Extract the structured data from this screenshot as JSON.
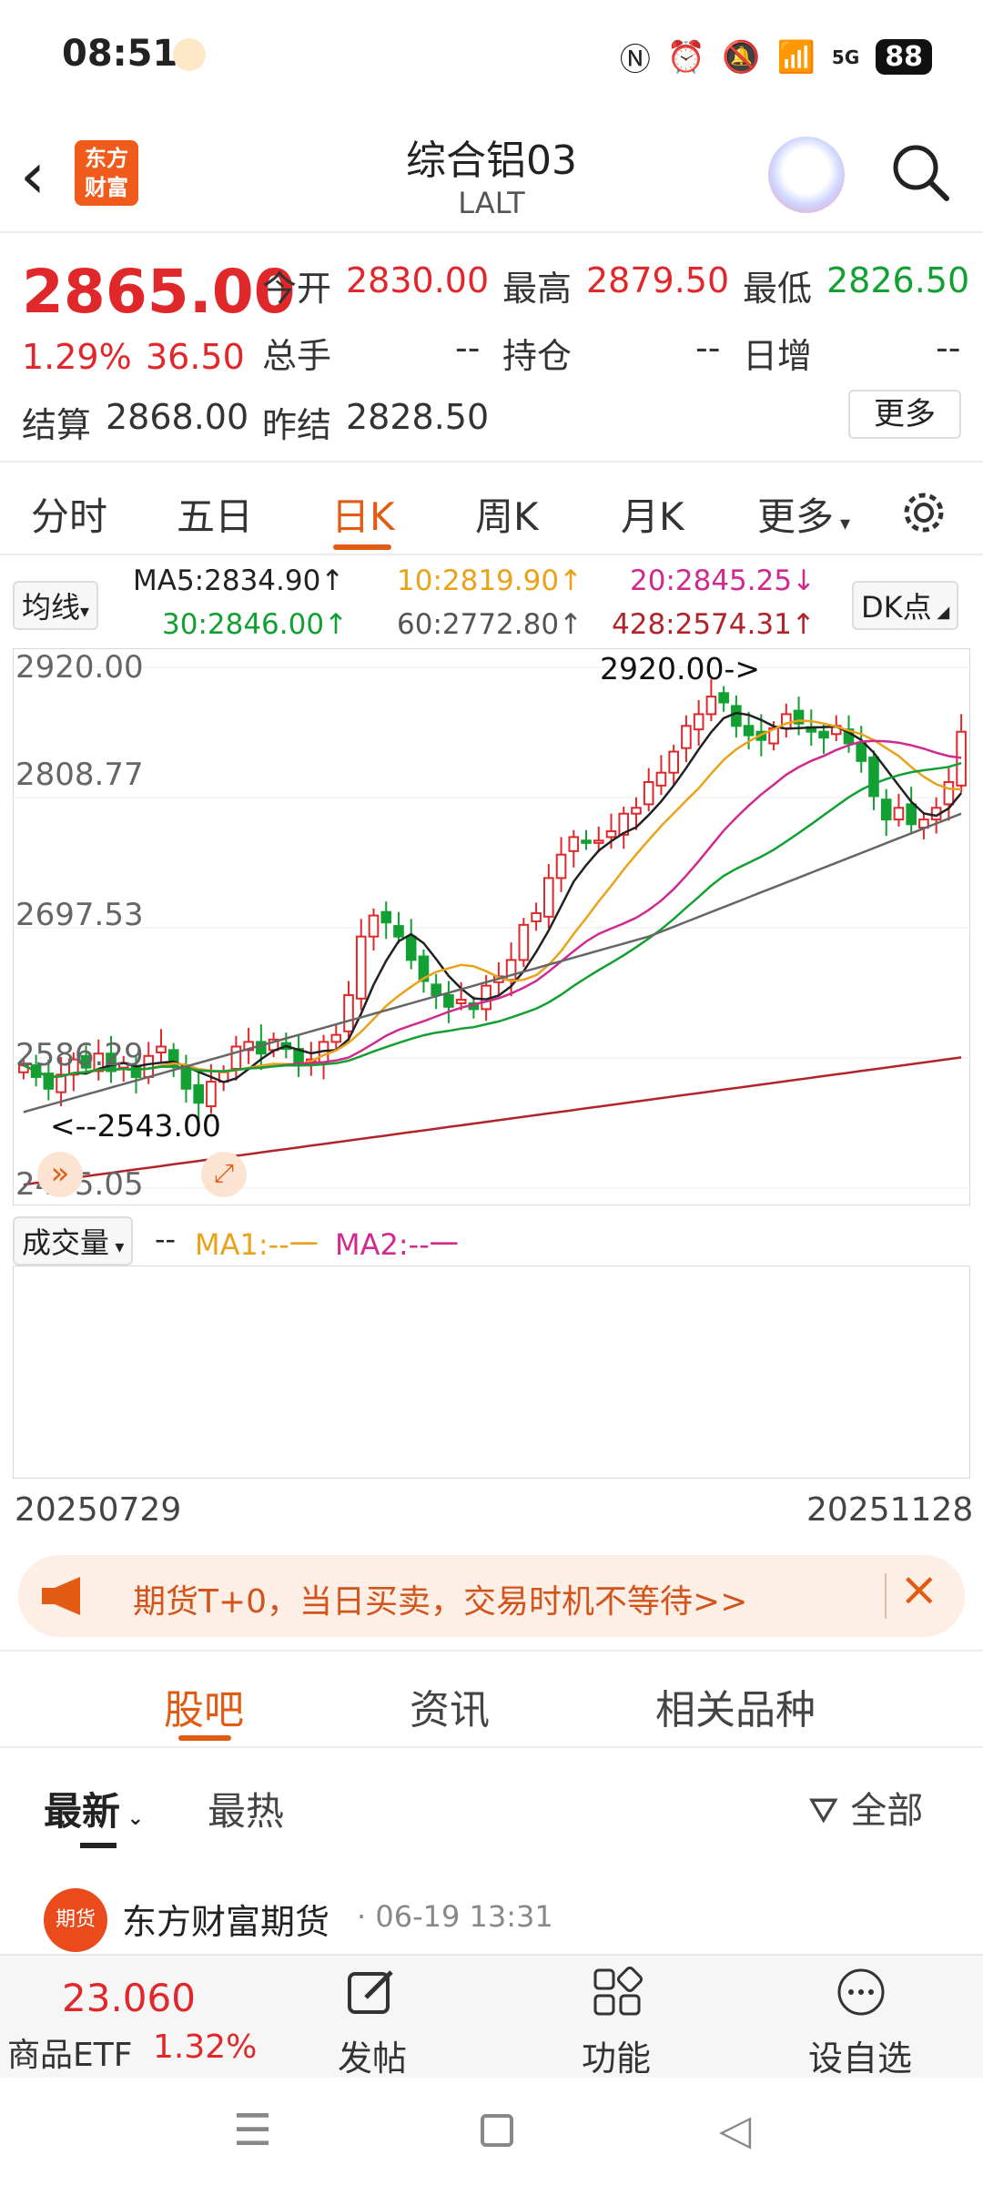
{
  "status_bar": {
    "time": "08:51",
    "battery": "88",
    "network": "5G"
  },
  "header": {
    "title": "综合铝03",
    "subtitle": "LALT",
    "logo_text_line1": "东方",
    "logo_text_line2": "财富"
  },
  "quote": {
    "price": "2865.00",
    "change_pct": "1.29%",
    "change": "36.50",
    "open_label": "今开",
    "open": "2830.00",
    "high_label": "最高",
    "high": "2879.50",
    "low_label": "最低",
    "low": "2826.50",
    "volume_label": "总手",
    "volume": "--",
    "oi_label": "持仓",
    "oi": "--",
    "daily_inc_label": "日增",
    "daily_inc": "--",
    "settle_label": "结算",
    "settle": "2868.00",
    "prev_settle_label": "昨结",
    "prev_settle": "2828.50",
    "more_label": "更多"
  },
  "tabs": {
    "t1": "分时",
    "t2": "五日",
    "t3": "日K",
    "t4": "周K",
    "t5": "月K",
    "t6": "更多"
  },
  "ma_row": {
    "ma_button": "均线",
    "ma5": "MA5:2834.90↑",
    "ma10": "10:2819.90↑",
    "ma20": "20:2845.25↓",
    "ma30": "30:2846.00↑",
    "ma60": "60:2772.80↑",
    "ma428": "428:2574.31↑",
    "dk_button": "DK点"
  },
  "chart_data": {
    "type": "candlestick",
    "yticks": [
      "2920.00",
      "2808.77",
      "2697.53",
      "2586.29",
      "2475.05"
    ],
    "ylim": [
      2475.05,
      2920.0
    ],
    "high_marker": "2920.00->",
    "low_marker": "<--2543.00",
    "x_start": "20250729",
    "x_end": "20251128",
    "closes": [
      2580,
      2570,
      2560,
      2572,
      2585,
      2578,
      2590,
      2575,
      2582,
      2570,
      2588,
      2596,
      2580,
      2560,
      2548,
      2566,
      2574,
      2596,
      2600,
      2590,
      2602,
      2594,
      2580,
      2585,
      2600,
      2606,
      2640,
      2690,
      2708,
      2702,
      2690,
      2670,
      2652,
      2640,
      2630,
      2636,
      2628,
      2648,
      2656,
      2670,
      2700,
      2710,
      2740,
      2760,
      2775,
      2770,
      2772,
      2780,
      2795,
      2800,
      2822,
      2830,
      2848,
      2870,
      2880,
      2895,
      2890,
      2870,
      2862,
      2858,
      2868,
      2880,
      2872,
      2865,
      2860,
      2870,
      2855,
      2840,
      2810,
      2790,
      2800,
      2786,
      2790,
      2800,
      2822,
      2865
    ],
    "ma_colors": {
      "ma5": "#222222",
      "ma10": "#e9a21a",
      "ma20": "#d02a8e",
      "ma30": "#12a032",
      "ma60": "#666666",
      "ma428": "#b0242a"
    }
  },
  "volume": {
    "label": "成交量",
    "dash": "--",
    "ma1": "MA1:--一",
    "ma2": "MA2:--一"
  },
  "banner": {
    "text": "期货T+0，当日买卖，交易时机不等待>>"
  },
  "community_tabs": {
    "t1": "股吧",
    "t2": "资讯",
    "t3": "相关品种"
  },
  "sort": {
    "latest": "最新",
    "hot": "最热",
    "filter": "全部"
  },
  "post": {
    "author": "东方财富期货",
    "time": "· 06-19 13:31",
    "avatar_text": "期货"
  },
  "bottom_bar": {
    "etf_value": "23.060",
    "etf_label": "商品ETF",
    "etf_pct": "1.32%",
    "post": "发帖",
    "func": "功能",
    "watch": "设自选"
  }
}
